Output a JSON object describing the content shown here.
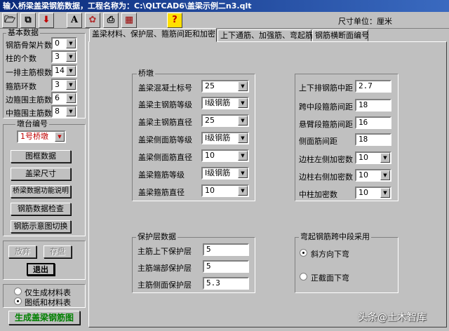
{
  "window": {
    "title": "输入桥梁盖梁钢筋数据，工程名称为：C:\\QLTCAD6\\盖梁示例二n3.qlt"
  },
  "toolbar": {
    "unit_label": "尺寸单位：厘米",
    "buttons": [
      {
        "icon": "open-icon",
        "glyph": "🗁"
      },
      {
        "icon": "copy-icon",
        "glyph": "⧉"
      },
      {
        "icon": "down-arrow-icon",
        "glyph": "⬇"
      },
      {
        "icon": "font-icon",
        "glyph": "A"
      },
      {
        "icon": "tools-icon",
        "glyph": "✿"
      },
      {
        "icon": "print-icon",
        "glyph": "⎙"
      },
      {
        "icon": "calculator-icon",
        "glyph": "▦"
      },
      {
        "icon": "help-icon",
        "glyph": "?"
      }
    ]
  },
  "basic": {
    "title": "基本数据",
    "rows": [
      {
        "label": "钢筋骨架片数",
        "value": "0"
      },
      {
        "label": "柱的个数",
        "value": "3"
      },
      {
        "label": "一排主筋根数",
        "value": "14"
      },
      {
        "label": "箍筋环数",
        "value": "3"
      },
      {
        "label": "边箍围主筋数",
        "value": "6"
      },
      {
        "label": "中箍围主筋数",
        "value": "8"
      }
    ]
  },
  "pier": {
    "title": "墩台编号",
    "selected": "1号桥墩",
    "buttons": [
      "图框数据",
      "盖梁尺寸",
      "桥梁数据功能说明",
      "钢筋数据检查",
      "钢筋示意图切换"
    ]
  },
  "actions": {
    "discard": "放弃",
    "save": "存盘",
    "exit": "退出"
  },
  "output_mode": {
    "options": [
      "仅生成材料表",
      "图纸和材料表"
    ],
    "selected": 1
  },
  "generate_button": "生成盖梁钢筋图",
  "tabs": [
    "盖梁材料、保护层、箍筋间距和加密",
    "上下通筋、加强筋、弯起筋",
    "钢筋横断面编号"
  ],
  "bridge_pier": {
    "title": "桥墩",
    "rows": [
      {
        "label": "盖梁混凝土标号",
        "value": "25"
      },
      {
        "label": "盖梁主钢筋等级",
        "value": "Ⅰ级钢筋"
      },
      {
        "label": "盖梁主钢筋直径",
        "value": "25"
      },
      {
        "label": "盖梁侧面筋等级",
        "value": "Ⅰ级钢筋"
      },
      {
        "label": "盖梁侧面筋直径",
        "value": "10"
      },
      {
        "label": "盖梁箍筋等级",
        "value": "Ⅰ级钢筋"
      },
      {
        "label": "盖梁箍筋直径",
        "value": "10"
      }
    ]
  },
  "spacing": {
    "rows": [
      {
        "label": "上下排钢筋中距",
        "value": "2.7",
        "kind": "input"
      },
      {
        "label": "跨中段箍筋间距",
        "value": "18",
        "kind": "input"
      },
      {
        "label": "悬臂段箍筋间距",
        "value": "16",
        "kind": "input"
      },
      {
        "label": "侧面筋间距",
        "value": "18",
        "kind": "input"
      },
      {
        "label": "边柱左侧加密数",
        "value": "10",
        "kind": "combo"
      },
      {
        "label": "边柱右侧加密数",
        "value": "10",
        "kind": "combo"
      },
      {
        "label": "中柱加密数",
        "value": "10",
        "kind": "combo"
      }
    ]
  },
  "cover": {
    "title": "保护层数据",
    "rows": [
      {
        "label": "主筋上下保护层",
        "value": "5"
      },
      {
        "label": "主筋端部保护层",
        "value": "5"
      },
      {
        "label": "主筋侧面保护层",
        "value": "5.3"
      }
    ]
  },
  "bent_bar": {
    "title": "弯起钢筋跨中段采用",
    "options": [
      "斜方向下弯",
      "正截面下弯"
    ],
    "selected": 0
  },
  "watermark": "头条@土木智库"
}
